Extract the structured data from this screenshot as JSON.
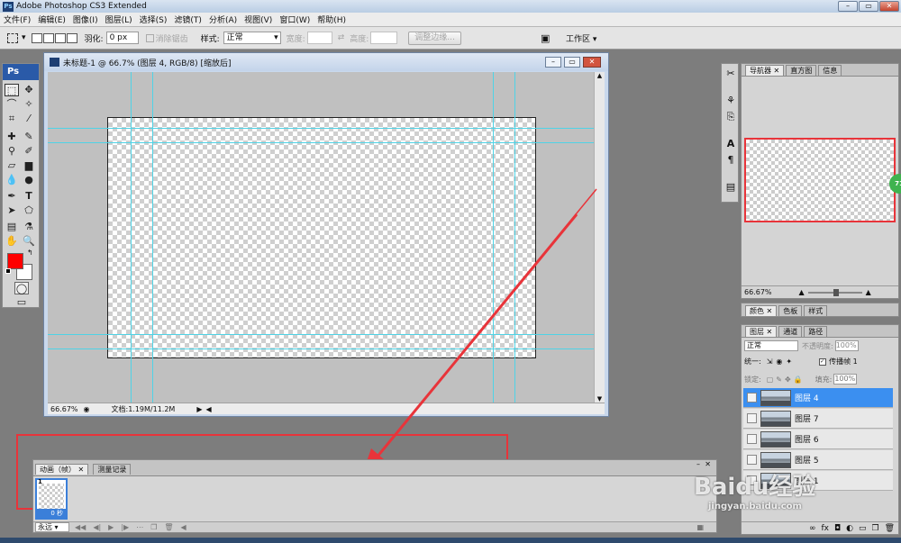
{
  "app": {
    "title": "Adobe Photoshop CS3 Extended",
    "logo": "Ps"
  },
  "menu": [
    "文件(F)",
    "编辑(E)",
    "图像(I)",
    "图层(L)",
    "选择(S)",
    "滤镜(T)",
    "分析(A)",
    "视图(V)",
    "窗口(W)",
    "帮助(H)"
  ],
  "options": {
    "feather_label": "羽化:",
    "feather_value": "0 px",
    "antialias_label": "消除锯齿",
    "style_label": "样式:",
    "style_value": "正常",
    "width_label": "宽度:",
    "height_label": "高度:",
    "refine_button": "调整边缘...",
    "workspace_label": "工作区"
  },
  "toolbox": {
    "logo": "Ps"
  },
  "document": {
    "title": "未标题-1 @ 66.7% (图层 4, RGB/8) [缩放后]",
    "zoom": "66.67%",
    "doc_info": "文档:1.19M/11.2M"
  },
  "navigator": {
    "tabs": [
      "导航器",
      "直方图",
      "信息"
    ],
    "zoom": "66.67%",
    "badge": "71"
  },
  "color_panel": {
    "tabs": [
      "颜色",
      "色板",
      "样式"
    ]
  },
  "layers_panel": {
    "tabs": [
      "图层",
      "通道",
      "路径"
    ],
    "blend_mode": "正常",
    "opacity_label": "不透明度:",
    "opacity_value": "100%",
    "unify_label": "统一:",
    "propagate_label": "传播帧 1",
    "lock_label": "锁定:",
    "fill_label": "填充:",
    "fill_value": "100%",
    "layers": [
      {
        "name": "图层 4",
        "selected": true
      },
      {
        "name": "图层 7",
        "selected": false
      },
      {
        "name": "图层 6",
        "selected": false
      },
      {
        "name": "图层 5",
        "selected": false
      },
      {
        "name": "图层 1",
        "selected": false
      }
    ]
  },
  "animation_panel": {
    "tabs": [
      "动画（帧）",
      "测量记录"
    ],
    "frame_number": "1",
    "frame_delay": "0 秒",
    "loop": "永远"
  },
  "watermark": {
    "text": "Baidu经验",
    "sub": "jingyan.baidu.com"
  },
  "colors": {
    "accent": "#e8343a",
    "selection": "#3b8ff0",
    "guide": "#4fd3e6",
    "foreground": "#ff0000"
  }
}
